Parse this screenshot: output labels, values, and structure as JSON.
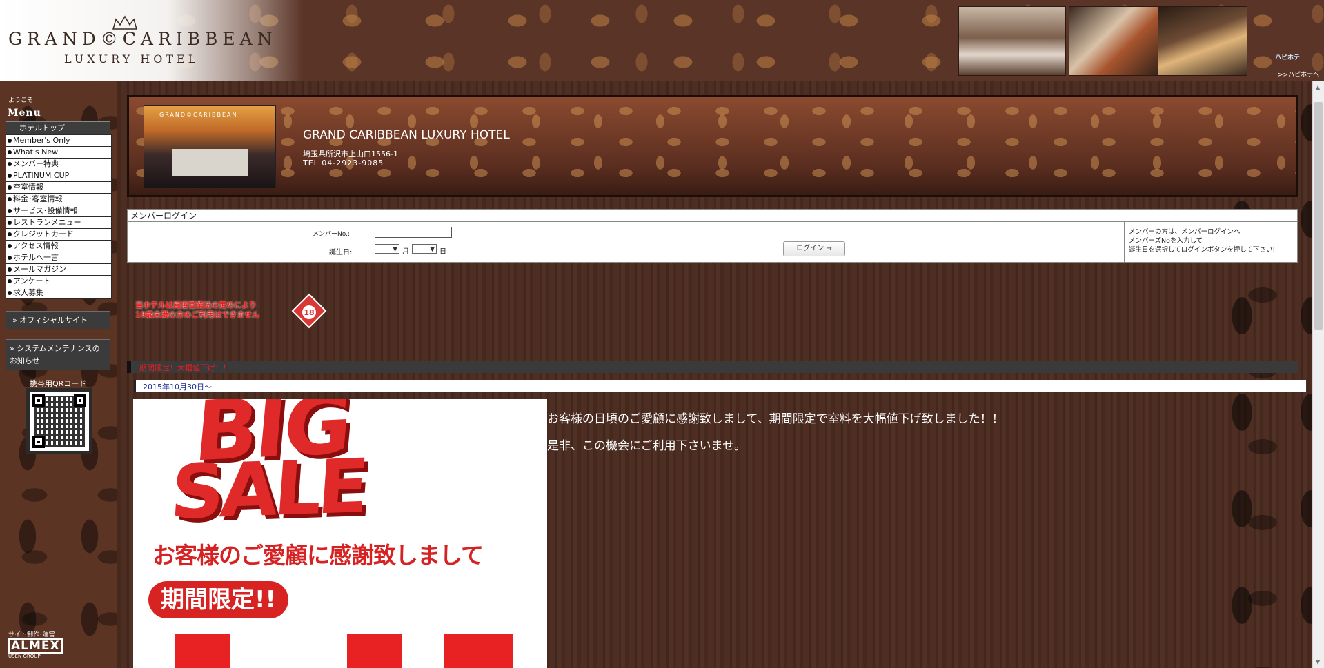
{
  "header": {
    "logo_line1": "GRAND©CARIBBEAN",
    "logo_line2": "LUXURY HOTEL",
    "happyhotel_logo": "ハピホテ",
    "happyhotel_link": ">>ハピホテへ"
  },
  "sidebar": {
    "welcome": "ようこそ",
    "menu_title": "Menu",
    "menu_header": "ホテルトップ",
    "items": [
      {
        "label": "Member's Only"
      },
      {
        "label": "What's New"
      },
      {
        "label": "メンバー特典"
      },
      {
        "label": "PLATINUM CUP"
      },
      {
        "label": "空室情報"
      },
      {
        "label": "料金･客室情報"
      },
      {
        "label": "サービス･設備情報"
      },
      {
        "label": "レストランメニュー"
      },
      {
        "label": "クレジットカード"
      },
      {
        "label": "アクセス情報"
      },
      {
        "label": "ホテルへ一言"
      },
      {
        "label": "メールマガジン"
      },
      {
        "label": "アンケート"
      },
      {
        "label": "求人募集"
      }
    ],
    "official_site": "オフィシャルサイト",
    "maintenance": "システムメンテナンスのお知らせ",
    "qr_label": "携帯用QRコード",
    "almex_top": "サイト制作･運営",
    "almex_main": "ALMEX",
    "almex_sub": "USEN GROUP"
  },
  "banner": {
    "photo_brand": "GRAND©CARIBBEAN",
    "hotel_name": "GRAND CARIBBEAN LUXURY HOTEL",
    "address": "埼玉県所沢市上山口1556-1",
    "tel": "TEL 04-2923-9085"
  },
  "login": {
    "title": "メンバーログイン",
    "member_label": "メンバーNo.:",
    "member_value": "",
    "dob_label": "誕生日:",
    "month_unit": "月",
    "day_unit": "日",
    "button": "ログイン →",
    "help_line1": "メンバーの方は、メンバーログインへ",
    "help_line2": "メンバーズNoを入力して",
    "help_line3": "誕生日を選択してログインボタンを押して下さい!"
  },
  "age_notice": {
    "line1": "当ホテルは風俗営業法の定めにより",
    "line2": "18歳未満の方のご利用はできません",
    "badge": "18"
  },
  "news": {
    "title": "期間限定！大幅値下げ！！",
    "date": "2015年10月30日～",
    "sale_big": "BIG",
    "sale_sale": "SALE",
    "sale_thanks": "お客様のご愛顧に感謝致しまして",
    "sale_limited": "期間限定!!",
    "message1": "お客様の日頃のご愛顧に感謝致しまして、期間限定で室料を大幅値下げ致しました！！",
    "message2": "是非、この機会にご利用下さいませ。"
  },
  "colors": {
    "background": "#4a2a1f",
    "accent_red": "#e02a2a",
    "menu_dark": "#3b3b3b"
  }
}
